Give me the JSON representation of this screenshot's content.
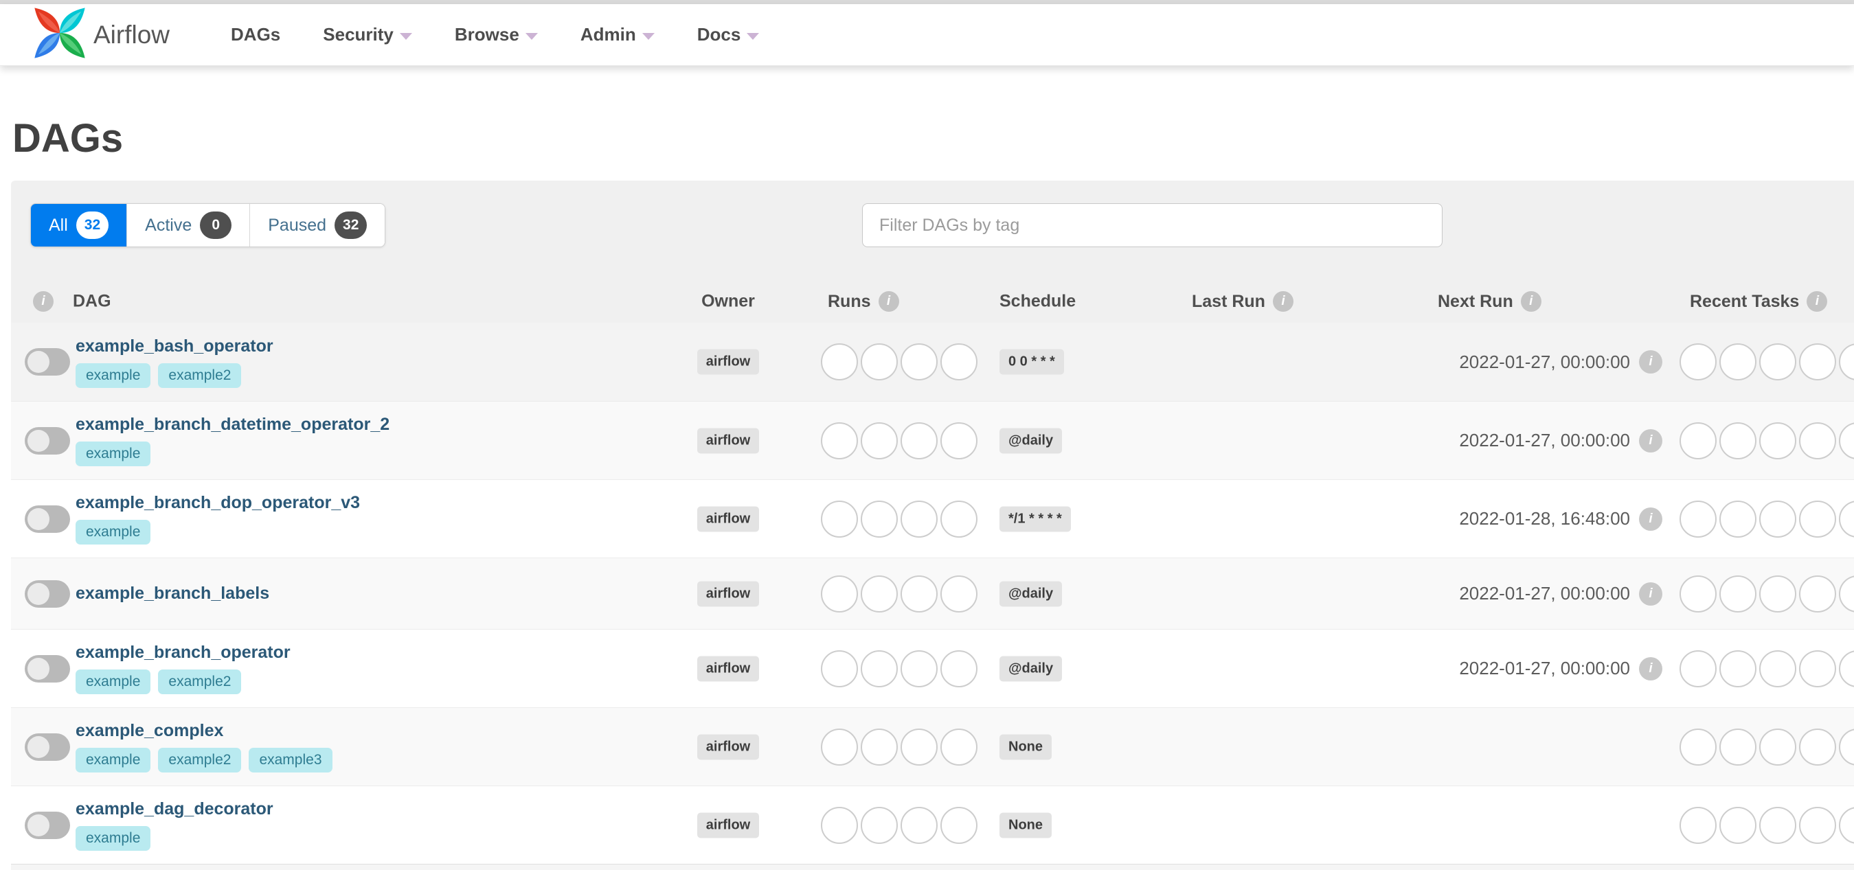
{
  "nav": {
    "brand": "Airflow",
    "items": [
      {
        "label": "DAGs"
      },
      {
        "label": "Security"
      },
      {
        "label": "Browse"
      },
      {
        "label": "Admin"
      },
      {
        "label": "Docs"
      }
    ]
  },
  "page": {
    "title": "DAGs"
  },
  "filters": {
    "tabs": [
      {
        "label": "All",
        "count": "32",
        "active": true
      },
      {
        "label": "Active",
        "count": "0",
        "active": false
      },
      {
        "label": "Paused",
        "count": "32",
        "active": false
      }
    ],
    "search_placeholder": "Filter DAGs by tag"
  },
  "table": {
    "columns": {
      "dag": "DAG",
      "owner": "Owner",
      "runs": "Runs",
      "schedule": "Schedule",
      "last_run": "Last Run",
      "next_run": "Next Run",
      "recent_tasks": "Recent Tasks"
    },
    "runs_circle_count": 4,
    "recent_tasks_circle_count": 5,
    "rows": [
      {
        "name": "example_bash_operator",
        "tags": [
          "example",
          "example2"
        ],
        "owner": "airflow",
        "schedule": "0 0 * * *",
        "last_run": "",
        "next_run": "2022-01-27, 00:00:00"
      },
      {
        "name": "example_branch_datetime_operator_2",
        "tags": [
          "example"
        ],
        "owner": "airflow",
        "schedule": "@daily",
        "last_run": "",
        "next_run": "2022-01-27, 00:00:00"
      },
      {
        "name": "example_branch_dop_operator_v3",
        "tags": [
          "example"
        ],
        "owner": "airflow",
        "schedule": "*/1 * * * *",
        "last_run": "",
        "next_run": "2022-01-28, 16:48:00"
      },
      {
        "name": "example_branch_labels",
        "tags": [],
        "owner": "airflow",
        "schedule": "@daily",
        "last_run": "",
        "next_run": "2022-01-27, 00:00:00"
      },
      {
        "name": "example_branch_operator",
        "tags": [
          "example",
          "example2"
        ],
        "owner": "airflow",
        "schedule": "@daily",
        "last_run": "",
        "next_run": "2022-01-27, 00:00:00"
      },
      {
        "name": "example_complex",
        "tags": [
          "example",
          "example2",
          "example3"
        ],
        "owner": "airflow",
        "schedule": "None",
        "last_run": "",
        "next_run": ""
      },
      {
        "name": "example_dag_decorator",
        "tags": [
          "example"
        ],
        "owner": "airflow",
        "schedule": "None",
        "last_run": "",
        "next_run": ""
      }
    ]
  },
  "colors": {
    "accent": "#017cee",
    "link": "#2b5877",
    "tag_bg": "#b9eaf0",
    "tag_text": "#2e7c91",
    "badge_bg": "#e3e3e3"
  }
}
